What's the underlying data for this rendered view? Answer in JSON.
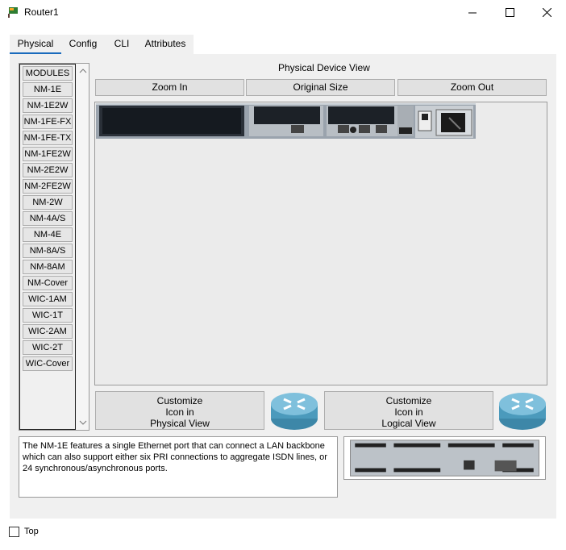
{
  "window": {
    "title": "Router1"
  },
  "tabs": [
    {
      "label": "Physical",
      "active": true
    },
    {
      "label": "Config",
      "active": false
    },
    {
      "label": "CLI",
      "active": false
    },
    {
      "label": "Attributes",
      "active": false
    }
  ],
  "modules": {
    "items": [
      "MODULES",
      "NM-1E",
      "NM-1E2W",
      "NM-1FE-FX",
      "NM-1FE-TX",
      "NM-1FE2W",
      "NM-2E2W",
      "NM-2FE2W",
      "NM-2W",
      "NM-4A/S",
      "NM-4E",
      "NM-8A/S",
      "NM-8AM",
      "NM-Cover",
      "WIC-1AM",
      "WIC-1T",
      "WIC-2AM",
      "WIC-2T",
      "WIC-Cover"
    ]
  },
  "device_view": {
    "label": "Physical Device View",
    "zoom_in": "Zoom In",
    "original_size": "Original Size",
    "zoom_out": "Zoom Out"
  },
  "customize": {
    "physical": [
      "Customize",
      "Icon in",
      "Physical View"
    ],
    "logical": [
      "Customize",
      "Icon in",
      "Logical View"
    ]
  },
  "description": "The NM-1E features a single Ethernet port that can connect a LAN backbone which can also support either six PRI connections to aggregate ISDN lines, or 24 synchronous/asynchronous ports.",
  "footer": {
    "top_label": "Top",
    "top_checked": false
  },
  "colors": {
    "tab_accent": "#1a6bbd",
    "router_blue": "#5ba8c8"
  },
  "icons": [
    "app-router-icon",
    "minimize-icon",
    "maximize-icon",
    "close-icon",
    "chevron-up-icon",
    "chevron-down-icon",
    "router-icon"
  ]
}
